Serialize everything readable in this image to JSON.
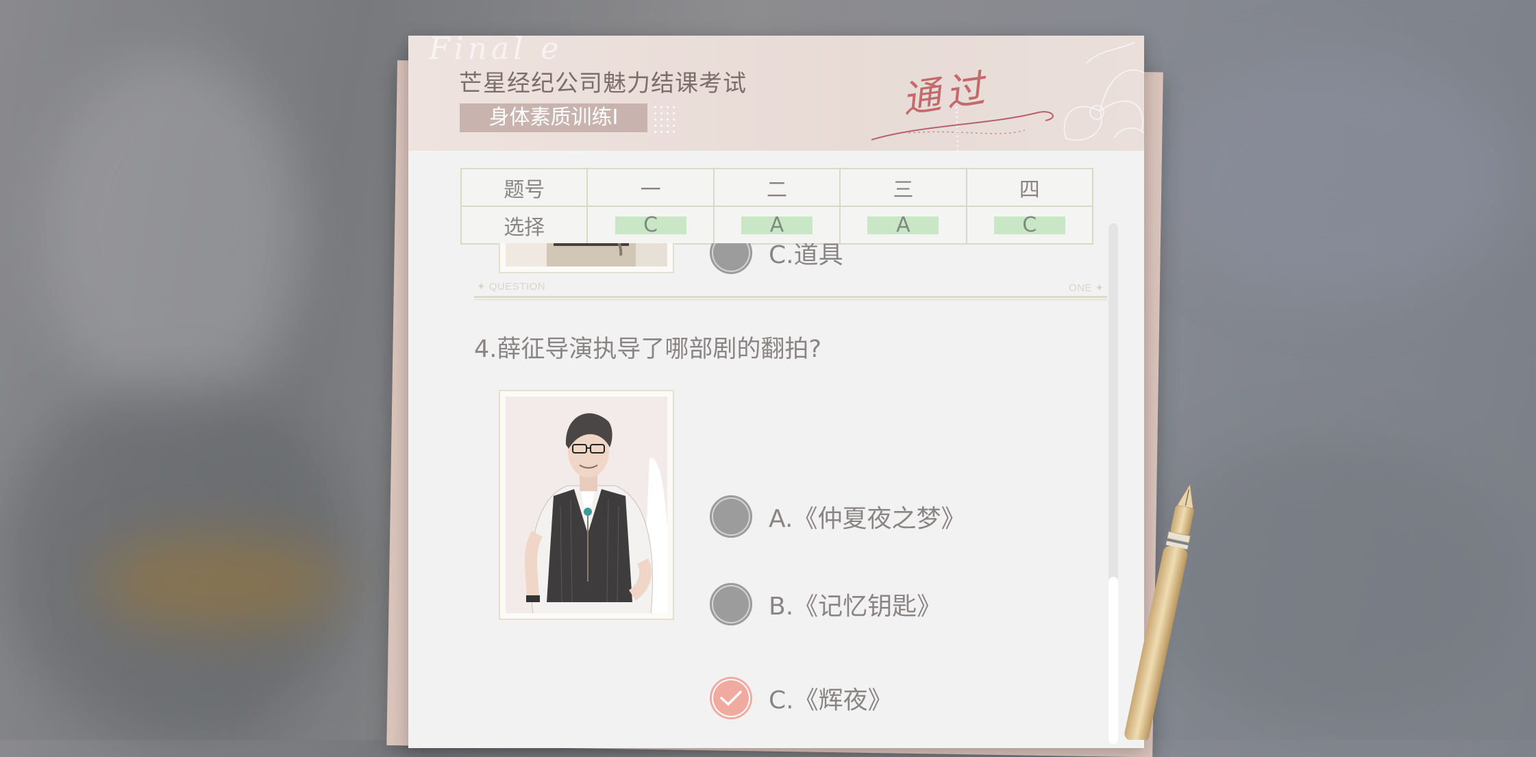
{
  "exam": {
    "title": "芒星经纪公司魅力结课考试",
    "subject": "身体素质训练Ⅰ",
    "result_stamp": "通过",
    "deco_script": "Final e"
  },
  "answer_table": {
    "row_labels": [
      "题号",
      "选择"
    ],
    "columns": [
      {
        "number": "一",
        "answer": "C"
      },
      {
        "number": "二",
        "answer": "A"
      },
      {
        "number": "三",
        "answer": "A"
      },
      {
        "number": "四",
        "answer": "C"
      }
    ]
  },
  "prev_question": {
    "options": [
      {
        "label": "C.道具",
        "selected": false
      }
    ]
  },
  "divider": {
    "left_tag": "QUESTION",
    "right_tag": "ONE"
  },
  "question4": {
    "text": "4.薛征导演执导了哪部剧的翻拍?",
    "options": [
      {
        "label": "A.《仲夏夜之梦》",
        "selected": false
      },
      {
        "label": "B.《记忆钥匙》",
        "selected": false
      },
      {
        "label": "C.《辉夜》",
        "selected": true
      }
    ]
  },
  "colors": {
    "header_bg": "#e8dbd6",
    "subject_tag": "#c9b3ae",
    "stamp": "#c46a6c",
    "answer_highlight": "#c9e7c6",
    "selected_option": "#f1aaa0",
    "unselected_option": "#9c9c9c"
  }
}
